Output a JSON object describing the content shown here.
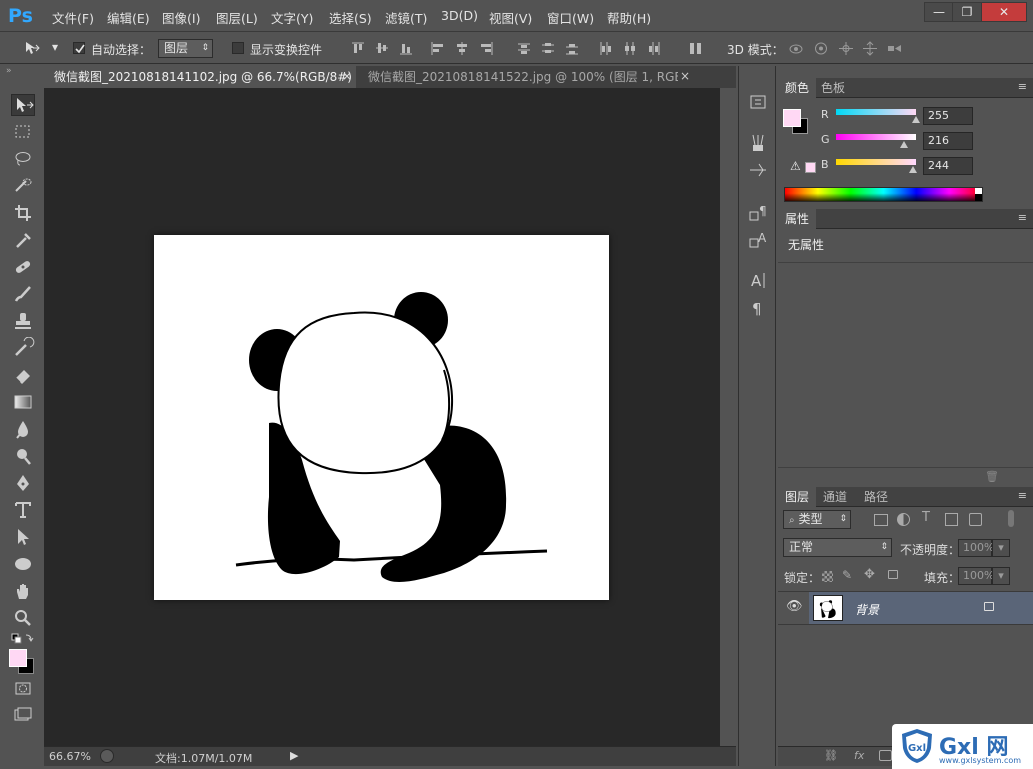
{
  "app": {
    "logo": "Ps",
    "menu": [
      "文件(F)",
      "编辑(E)",
      "图像(I)",
      "图层(L)",
      "文字(Y)",
      "选择(S)",
      "滤镜(T)",
      "3D(D)",
      "视图(V)",
      "窗口(W)",
      "帮助(H)"
    ],
    "window_controls": {
      "minimize": "—",
      "restore": "❐",
      "close": "✕"
    }
  },
  "options_bar": {
    "auto_select_label": "自动选择：",
    "auto_select_checked": true,
    "auto_select_target": "图层",
    "show_transform_label": "显示变换控件",
    "show_transform_checked": false,
    "mode_3d_label": "3D 模式："
  },
  "tabs": [
    {
      "title": "微信截图_20210818141102.jpg @ 66.7%(RGB/8#) *",
      "active": true,
      "close": "×"
    },
    {
      "title": "微信截图_20210818141522.jpg @ 100% (图层 1, RGB/...",
      "active": false,
      "close": "×"
    }
  ],
  "status": {
    "zoom": "66.67%",
    "doc_info": "文档:1.07M/1.07M"
  },
  "colors": {
    "foreground": "#ffd8f4",
    "background": "#000000",
    "accent": "#31a8ff",
    "layer_selected": "#5a6578"
  },
  "color_panel": {
    "tabs": [
      "颜色",
      "色板"
    ],
    "r_label": "R",
    "g_label": "G",
    "b_label": "B",
    "r": 255,
    "g": 216,
    "b": 244,
    "r_value": "255",
    "g_value": "216",
    "b_value": "244"
  },
  "properties_panel": {
    "tab": "属性",
    "content": "无属性"
  },
  "layers_panel": {
    "tabs": [
      "图层",
      "通道",
      "路径"
    ],
    "filter_kind": "类型",
    "blend_mode": "正常",
    "opacity_label": "不透明度：",
    "opacity_value": "100%",
    "lock_label": "锁定：",
    "fill_label": "填充：",
    "fill_value": "100%",
    "layers": [
      {
        "name": "背景",
        "visible": true,
        "locked": true
      }
    ]
  },
  "watermark": {
    "brand": "Gxl 网",
    "url": "www.gxlsystem.com"
  }
}
